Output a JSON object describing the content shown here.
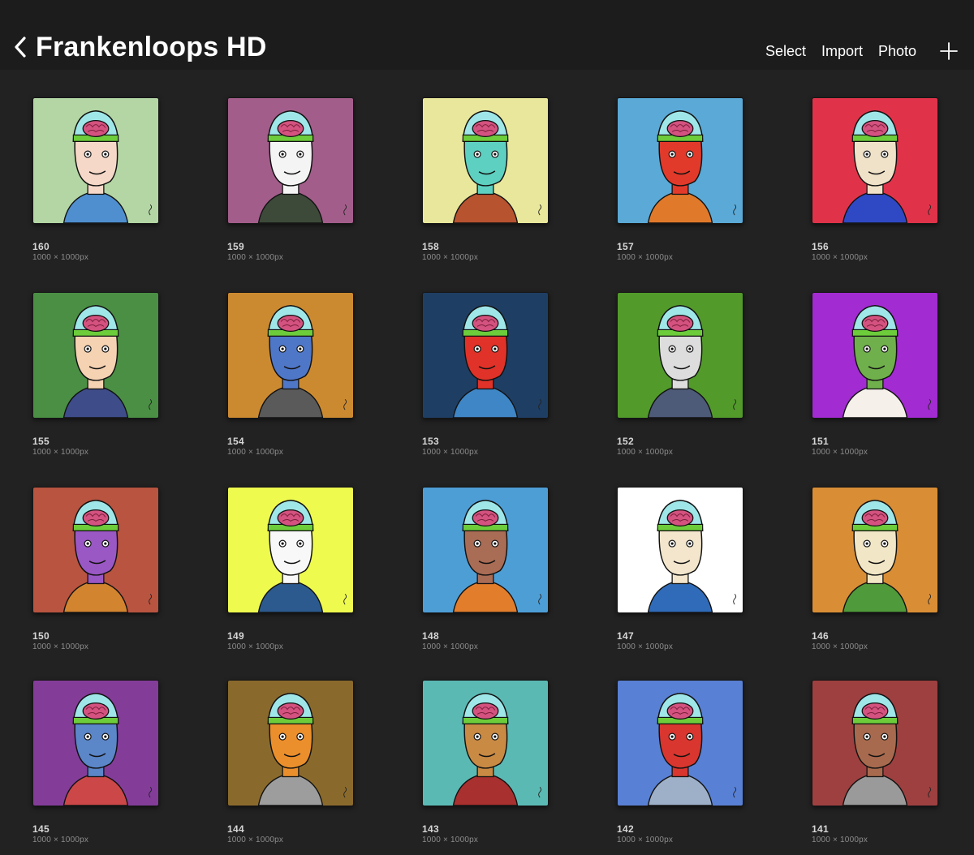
{
  "header": {
    "title": "Frankenloops HD",
    "actions": [
      {
        "label": "Select",
        "name": "select-button"
      },
      {
        "label": "Import",
        "name": "import-button"
      },
      {
        "label": "Photo",
        "name": "photo-button"
      }
    ],
    "back_icon": "chevron-left-icon",
    "add_icon": "plus-icon"
  },
  "artworks": [
    {
      "name": "160",
      "size": "1000 × 1000px",
      "bg": "#b3d6a4",
      "skin": "#f6d8c8",
      "shirt": "#4f8fcf"
    },
    {
      "name": "159",
      "size": "1000 × 1000px",
      "bg": "#a35d8a",
      "skin": "#f4f4f4",
      "shirt": "#3d4a3a"
    },
    {
      "name": "158",
      "size": "1000 × 1000px",
      "bg": "#e8e79b",
      "skin": "#5ed0c1",
      "shirt": "#b7532f"
    },
    {
      "name": "157",
      "size": "1000 × 1000px",
      "bg": "#5aa9d6",
      "skin": "#e23a2a",
      "shirt": "#e07a2a"
    },
    {
      "name": "156",
      "size": "1000 × 1000px",
      "bg": "#e0334a",
      "skin": "#f0e2c8",
      "shirt": "#2f49c4"
    },
    {
      "name": "155",
      "size": "1000 × 1000px",
      "bg": "#4a8f44",
      "skin": "#f5d2b2",
      "shirt": "#3e4c8a"
    },
    {
      "name": "154",
      "size": "1000 × 1000px",
      "bg": "#cc8a30",
      "skin": "#4f77c8",
      "shirt": "#5a5a5a"
    },
    {
      "name": "153",
      "size": "1000 × 1000px",
      "bg": "#1f3e63",
      "skin": "#e03228",
      "shirt": "#3f86c6"
    },
    {
      "name": "152",
      "size": "1000 × 1000px",
      "bg": "#529a2a",
      "skin": "#dddddd",
      "shirt": "#4d5a78"
    },
    {
      "name": "151",
      "size": "1000 × 1000px",
      "bg": "#a22bd1",
      "skin": "#70b04c",
      "shirt": "#f5f0ea"
    },
    {
      "name": "150",
      "size": "1000 × 1000px",
      "bg": "#b85440",
      "skin": "#9a58c4",
      "shirt": "#d2842f"
    },
    {
      "name": "149",
      "size": "1000 × 1000px",
      "bg": "#eefa4e",
      "skin": "#f8f8f8",
      "shirt": "#2c5a8e"
    },
    {
      "name": "148",
      "size": "1000 × 1000px",
      "bg": "#4e9ed6",
      "skin": "#a96c55",
      "shirt": "#e27d2c"
    },
    {
      "name": "147",
      "size": "1000 × 1000px",
      "bg": "#ffffff",
      "skin": "#f3e6cc",
      "shirt": "#2f6bb8"
    },
    {
      "name": "146",
      "size": "1000 × 1000px",
      "bg": "#d98e36",
      "skin": "#f1e7c6",
      "shirt": "#4f9a3a"
    },
    {
      "name": "145",
      "size": "1000 × 1000px",
      "bg": "#833d99",
      "skin": "#5b86c8",
      "shirt": "#cc4848"
    },
    {
      "name": "144",
      "size": "1000 × 1000px",
      "bg": "#8a6a2c",
      "skin": "#eb8f2c",
      "shirt": "#9d9d9d"
    },
    {
      "name": "143",
      "size": "1000 × 1000px",
      "bg": "#5bb9b4",
      "skin": "#c98a44",
      "shirt": "#a8302e"
    },
    {
      "name": "142",
      "size": "1000 × 1000px",
      "bg": "#5880d4",
      "skin": "#d8362e",
      "shirt": "#9eb0c8"
    },
    {
      "name": "141",
      "size": "1000 × 1000px",
      "bg": "#9e4040",
      "skin": "#a86a4e",
      "shirt": "#9a9a9a"
    }
  ]
}
